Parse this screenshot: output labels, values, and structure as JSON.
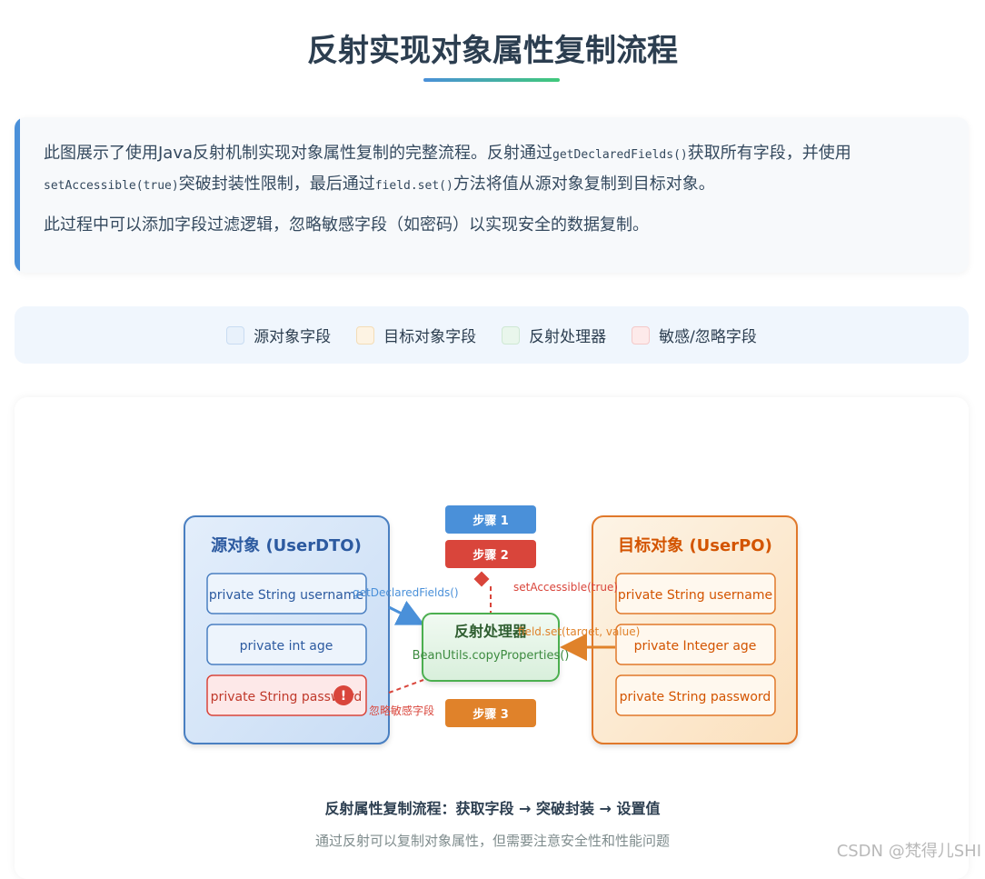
{
  "title": "反射实现对象属性复制流程",
  "intro": {
    "p1_a": "此图展示了使用Java反射机制实现对象属性复制的完整流程。反射通过",
    "p1_code1": "getDeclaredFields()",
    "p1_b": "获取所有字段，并使用",
    "p1_code2": "setAccessible(true)",
    "p1_c": "突破封装性限制，最后通过",
    "p1_code3": "field.set()",
    "p1_d": "方法将值从源对象复制到目标对象。",
    "p2": "此过程中可以添加字段过滤逻辑，忽略敏感字段（如密码）以实现安全的数据复制。"
  },
  "legend": [
    {
      "label": "源对象字段",
      "fill": "#e8f1fb",
      "border": "#c9dcf2"
    },
    {
      "label": "目标对象字段",
      "fill": "#fdf3e3",
      "border": "#f3dcb6"
    },
    {
      "label": "反射处理器",
      "fill": "#e9f6ec",
      "border": "#cfe8d4"
    },
    {
      "label": "敏感/忽略字段",
      "fill": "#fdeaea",
      "border": "#f4c9c9"
    }
  ],
  "diagram": {
    "source": {
      "title": "源对象 (UserDTO)",
      "fields": [
        "private String username",
        "private int age",
        "private String password"
      ]
    },
    "target": {
      "title": "目标对象 (UserPO)",
      "fields": [
        "private String username",
        "private Integer age",
        "private String password"
      ]
    },
    "processor": {
      "title": "反射处理器",
      "subtitle": "BeanUtils.copyProperties()"
    },
    "steps": [
      "步骤 1",
      "步骤 2",
      "步骤 3"
    ],
    "labels": {
      "get_fields": "getDeclaredFields()",
      "set_accessible": "setAccessible(true)",
      "field_set": "field.set(target, value)",
      "ignore": "忽略敏感字段"
    },
    "warning_mark": "!"
  },
  "colors": {
    "source": "#4a7fc1",
    "target": "#e0782a",
    "processor": "#4caf50",
    "sensitive": "#d9453b",
    "step1": "#4a90d9",
    "step2": "#d9453b",
    "step3": "#e0822a"
  },
  "caption": "反射属性复制流程：获取字段 → 突破封装 → 设置值",
  "subcaption": "通过反射可以复制对象属性，但需要注意安全性和性能问题",
  "watermark": "CSDN @梵得儿SHI"
}
